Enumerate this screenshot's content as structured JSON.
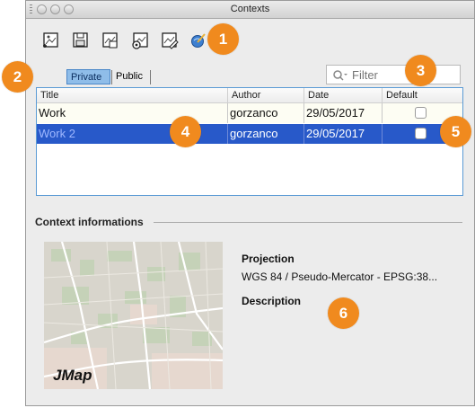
{
  "window": {
    "title": "Contexts"
  },
  "toolbar": {
    "buttons": [
      {
        "name": "new-context-icon"
      },
      {
        "name": "save-context-icon"
      },
      {
        "name": "save-as-context-icon"
      },
      {
        "name": "context-settings-icon"
      },
      {
        "name": "edit-context-icon"
      },
      {
        "name": "apply-context-icon"
      }
    ]
  },
  "tabs": {
    "private": "Private",
    "public": "Public"
  },
  "filter": {
    "placeholder": "Filter"
  },
  "table": {
    "columns": [
      "Title",
      "Author",
      "Date",
      "Default"
    ],
    "rows": [
      {
        "title": "Work",
        "author": "gorzanco",
        "date": "29/05/2017",
        "default": false
      },
      {
        "title": "Work 2",
        "author": "gorzanco",
        "date": "29/05/2017",
        "default": false
      }
    ]
  },
  "info": {
    "section_title": "Context informations",
    "projection_label": "Projection",
    "projection_value": "WGS 84 / Pseudo-Mercator - EPSG:38...",
    "description_label": "Description",
    "map_logo": "JMap"
  },
  "callouts": [
    "1",
    "2",
    "3",
    "4",
    "5",
    "6"
  ],
  "colors": {
    "callout": "#f08a1e",
    "selection": "#2859c9",
    "active_tab": "#8fbde9"
  }
}
